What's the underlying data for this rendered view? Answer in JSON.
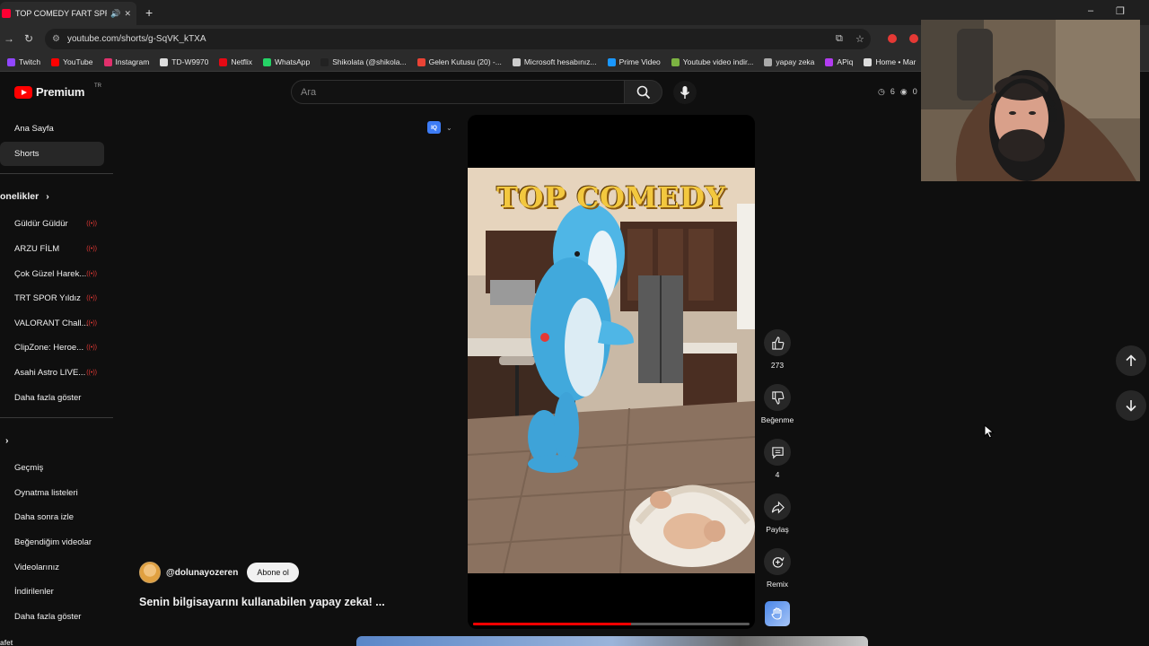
{
  "browser": {
    "tab_title": "TOP COMEDY FART SPRAY",
    "url": "youtube.com/shorts/g-SqVK_kTXA",
    "bookmarks": [
      {
        "label": "Twitch",
        "color": "#9146ff"
      },
      {
        "label": "YouTube",
        "color": "#ff0000"
      },
      {
        "label": "Instagram",
        "color": "#e1306c"
      },
      {
        "label": "TD-W9970",
        "color": "#dddddd"
      },
      {
        "label": "Netflix",
        "color": "#e50914"
      },
      {
        "label": "WhatsApp",
        "color": "#25d366"
      },
      {
        "label": "Shikolata (@shikola...",
        "color": "#222222"
      },
      {
        "label": "Gelen Kutusu (20) -...",
        "color": "#ea4335"
      },
      {
        "label": "Microsoft hesabınız...",
        "color": "#cccccc"
      },
      {
        "label": "Prime Video",
        "color": "#1a98ff"
      },
      {
        "label": "Youtube video indir...",
        "color": "#7cb342"
      },
      {
        "label": "yapay zeka",
        "color": "#aaaaaa"
      },
      {
        "label": "APiq",
        "color": "#b23cf0"
      },
      {
        "label": "Home • Mar",
        "color": "#dddddd"
      }
    ]
  },
  "header": {
    "logo_text": "Premium",
    "region": "TR",
    "search_placeholder": "Ara",
    "stat_a": "6",
    "stat_b": "0"
  },
  "sidebar": {
    "top_items": [
      "Ana Sayfa",
      "Shorts"
    ],
    "subscriptions_title": "onelikler",
    "subscriptions": [
      "Güldür Güldür",
      "ARZU FİLM",
      "Çok Güzel Harek...",
      "TRT SPOR Yıldız",
      "VALORANT Chall...",
      "ClipZone: Heroe...",
      "Asahi Astro LIVE..."
    ],
    "show_more_1": "Daha fazla göster",
    "you_items": [
      "Geçmiş",
      "Oynatma listeleri",
      "Daha sonra izle",
      "Beğendiğim videolar",
      "Videolarınız",
      "İndirilenler"
    ],
    "show_more_2": "Daha fazla göster",
    "bottom_cut": "afet"
  },
  "short": {
    "overlay_text": "TOP COMEDY",
    "chip_label": "IQ",
    "progress": 0.57,
    "channel_handle": "@dolunayozeren",
    "subscribe_label": "Abone ol",
    "title": "Senin bilgisayarını kullanabilen yapay zeka!  ..."
  },
  "actions": {
    "like_count": "273",
    "dislike_label": "Beğenme",
    "comment_count": "4",
    "share_label": "Paylaş",
    "remix_label": "Remix"
  }
}
